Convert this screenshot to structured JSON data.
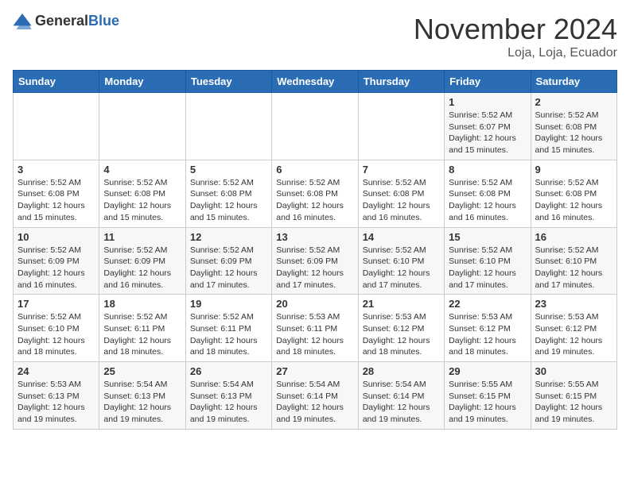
{
  "header": {
    "logo_general": "General",
    "logo_blue": "Blue",
    "month_title": "November 2024",
    "location": "Loja, Loja, Ecuador"
  },
  "weekdays": [
    "Sunday",
    "Monday",
    "Tuesday",
    "Wednesday",
    "Thursday",
    "Friday",
    "Saturday"
  ],
  "weeks": [
    [
      {
        "day": "",
        "sunrise": "",
        "sunset": "",
        "daylight": ""
      },
      {
        "day": "",
        "sunrise": "",
        "sunset": "",
        "daylight": ""
      },
      {
        "day": "",
        "sunrise": "",
        "sunset": "",
        "daylight": ""
      },
      {
        "day": "",
        "sunrise": "",
        "sunset": "",
        "daylight": ""
      },
      {
        "day": "",
        "sunrise": "",
        "sunset": "",
        "daylight": ""
      },
      {
        "day": "1",
        "sunrise": "Sunrise: 5:52 AM",
        "sunset": "Sunset: 6:07 PM",
        "daylight": "Daylight: 12 hours and 15 minutes."
      },
      {
        "day": "2",
        "sunrise": "Sunrise: 5:52 AM",
        "sunset": "Sunset: 6:08 PM",
        "daylight": "Daylight: 12 hours and 15 minutes."
      }
    ],
    [
      {
        "day": "3",
        "sunrise": "Sunrise: 5:52 AM",
        "sunset": "Sunset: 6:08 PM",
        "daylight": "Daylight: 12 hours and 15 minutes."
      },
      {
        "day": "4",
        "sunrise": "Sunrise: 5:52 AM",
        "sunset": "Sunset: 6:08 PM",
        "daylight": "Daylight: 12 hours and 15 minutes."
      },
      {
        "day": "5",
        "sunrise": "Sunrise: 5:52 AM",
        "sunset": "Sunset: 6:08 PM",
        "daylight": "Daylight: 12 hours and 15 minutes."
      },
      {
        "day": "6",
        "sunrise": "Sunrise: 5:52 AM",
        "sunset": "Sunset: 6:08 PM",
        "daylight": "Daylight: 12 hours and 16 minutes."
      },
      {
        "day": "7",
        "sunrise": "Sunrise: 5:52 AM",
        "sunset": "Sunset: 6:08 PM",
        "daylight": "Daylight: 12 hours and 16 minutes."
      },
      {
        "day": "8",
        "sunrise": "Sunrise: 5:52 AM",
        "sunset": "Sunset: 6:08 PM",
        "daylight": "Daylight: 12 hours and 16 minutes."
      },
      {
        "day": "9",
        "sunrise": "Sunrise: 5:52 AM",
        "sunset": "Sunset: 6:08 PM",
        "daylight": "Daylight: 12 hours and 16 minutes."
      }
    ],
    [
      {
        "day": "10",
        "sunrise": "Sunrise: 5:52 AM",
        "sunset": "Sunset: 6:09 PM",
        "daylight": "Daylight: 12 hours and 16 minutes."
      },
      {
        "day": "11",
        "sunrise": "Sunrise: 5:52 AM",
        "sunset": "Sunset: 6:09 PM",
        "daylight": "Daylight: 12 hours and 16 minutes."
      },
      {
        "day": "12",
        "sunrise": "Sunrise: 5:52 AM",
        "sunset": "Sunset: 6:09 PM",
        "daylight": "Daylight: 12 hours and 17 minutes."
      },
      {
        "day": "13",
        "sunrise": "Sunrise: 5:52 AM",
        "sunset": "Sunset: 6:09 PM",
        "daylight": "Daylight: 12 hours and 17 minutes."
      },
      {
        "day": "14",
        "sunrise": "Sunrise: 5:52 AM",
        "sunset": "Sunset: 6:10 PM",
        "daylight": "Daylight: 12 hours and 17 minutes."
      },
      {
        "day": "15",
        "sunrise": "Sunrise: 5:52 AM",
        "sunset": "Sunset: 6:10 PM",
        "daylight": "Daylight: 12 hours and 17 minutes."
      },
      {
        "day": "16",
        "sunrise": "Sunrise: 5:52 AM",
        "sunset": "Sunset: 6:10 PM",
        "daylight": "Daylight: 12 hours and 17 minutes."
      }
    ],
    [
      {
        "day": "17",
        "sunrise": "Sunrise: 5:52 AM",
        "sunset": "Sunset: 6:10 PM",
        "daylight": "Daylight: 12 hours and 18 minutes."
      },
      {
        "day": "18",
        "sunrise": "Sunrise: 5:52 AM",
        "sunset": "Sunset: 6:11 PM",
        "daylight": "Daylight: 12 hours and 18 minutes."
      },
      {
        "day": "19",
        "sunrise": "Sunrise: 5:52 AM",
        "sunset": "Sunset: 6:11 PM",
        "daylight": "Daylight: 12 hours and 18 minutes."
      },
      {
        "day": "20",
        "sunrise": "Sunrise: 5:53 AM",
        "sunset": "Sunset: 6:11 PM",
        "daylight": "Daylight: 12 hours and 18 minutes."
      },
      {
        "day": "21",
        "sunrise": "Sunrise: 5:53 AM",
        "sunset": "Sunset: 6:12 PM",
        "daylight": "Daylight: 12 hours and 18 minutes."
      },
      {
        "day": "22",
        "sunrise": "Sunrise: 5:53 AM",
        "sunset": "Sunset: 6:12 PM",
        "daylight": "Daylight: 12 hours and 18 minutes."
      },
      {
        "day": "23",
        "sunrise": "Sunrise: 5:53 AM",
        "sunset": "Sunset: 6:12 PM",
        "daylight": "Daylight: 12 hours and 19 minutes."
      }
    ],
    [
      {
        "day": "24",
        "sunrise": "Sunrise: 5:53 AM",
        "sunset": "Sunset: 6:13 PM",
        "daylight": "Daylight: 12 hours and 19 minutes."
      },
      {
        "day": "25",
        "sunrise": "Sunrise: 5:54 AM",
        "sunset": "Sunset: 6:13 PM",
        "daylight": "Daylight: 12 hours and 19 minutes."
      },
      {
        "day": "26",
        "sunrise": "Sunrise: 5:54 AM",
        "sunset": "Sunset: 6:13 PM",
        "daylight": "Daylight: 12 hours and 19 minutes."
      },
      {
        "day": "27",
        "sunrise": "Sunrise: 5:54 AM",
        "sunset": "Sunset: 6:14 PM",
        "daylight": "Daylight: 12 hours and 19 minutes."
      },
      {
        "day": "28",
        "sunrise": "Sunrise: 5:54 AM",
        "sunset": "Sunset: 6:14 PM",
        "daylight": "Daylight: 12 hours and 19 minutes."
      },
      {
        "day": "29",
        "sunrise": "Sunrise: 5:55 AM",
        "sunset": "Sunset: 6:15 PM",
        "daylight": "Daylight: 12 hours and 19 minutes."
      },
      {
        "day": "30",
        "sunrise": "Sunrise: 5:55 AM",
        "sunset": "Sunset: 6:15 PM",
        "daylight": "Daylight: 12 hours and 19 minutes."
      }
    ]
  ]
}
